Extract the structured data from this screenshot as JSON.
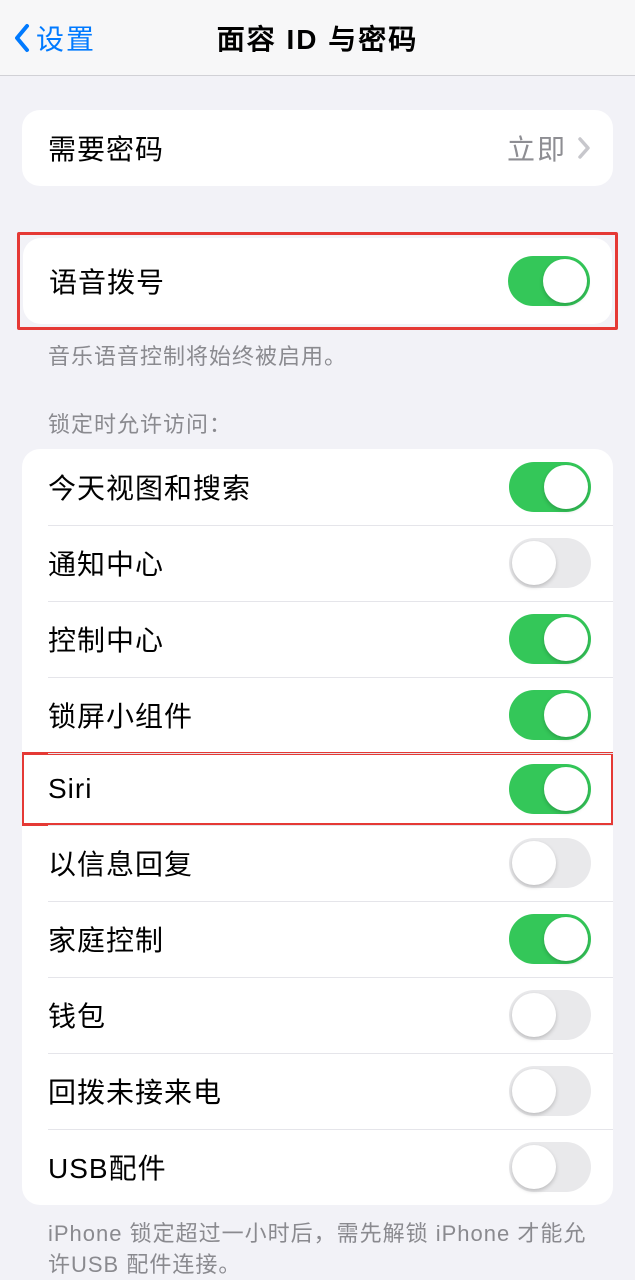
{
  "nav": {
    "back_label": "设置",
    "title": "面容 ID 与密码"
  },
  "passcode_row": {
    "label": "需要密码",
    "value": "立即"
  },
  "voice_dial": {
    "label": "语音拨号",
    "on": true,
    "footer": "音乐语音控制将始终被启用。"
  },
  "lock_section": {
    "header": "锁定时允许访问：",
    "items": [
      {
        "label": "今天视图和搜索",
        "on": true,
        "name": "today-view-search"
      },
      {
        "label": "通知中心",
        "on": false,
        "name": "notification-center"
      },
      {
        "label": "控制中心",
        "on": true,
        "name": "control-center"
      },
      {
        "label": "锁屏小组件",
        "on": true,
        "name": "lock-screen-widgets"
      },
      {
        "label": "Siri",
        "on": true,
        "name": "siri",
        "highlighted": true
      },
      {
        "label": "以信息回复",
        "on": false,
        "name": "reply-with-message"
      },
      {
        "label": "家庭控制",
        "on": true,
        "name": "home-control"
      },
      {
        "label": "钱包",
        "on": false,
        "name": "wallet"
      },
      {
        "label": "回拨未接来电",
        "on": false,
        "name": "return-missed-calls"
      },
      {
        "label": "USB配件",
        "on": false,
        "name": "usb-accessories"
      }
    ],
    "footer": "iPhone 锁定超过一小时后，需先解锁 iPhone 才能允许USB 配件连接。"
  }
}
